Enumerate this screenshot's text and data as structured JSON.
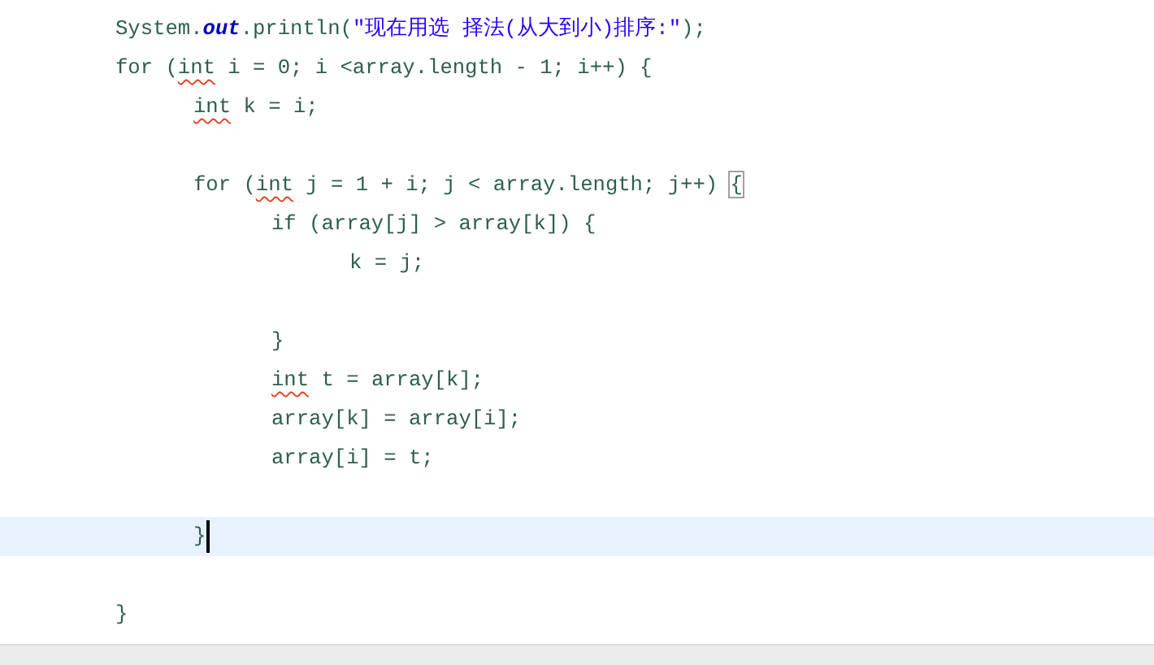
{
  "editor": {
    "lines": [
      {
        "kind": "code",
        "current": false,
        "tokens": [
          {
            "kind": "plain",
            "text": "\tSystem."
          },
          {
            "kind": "field",
            "text": "out"
          },
          {
            "kind": "plain",
            "text": ".println("
          },
          {
            "kind": "string",
            "text": "\"现在用选 择法(从大到小)排序:\""
          },
          {
            "kind": "plain",
            "text": ");"
          }
        ]
      },
      {
        "kind": "code",
        "current": false,
        "tokens": [
          {
            "kind": "plain",
            "text": "\tfor ("
          },
          {
            "kind": "warn",
            "text": "int"
          },
          {
            "kind": "plain",
            "text": " i = 0; i <array.length - 1; i++) {"
          }
        ]
      },
      {
        "kind": "code",
        "current": false,
        "tokens": [
          {
            "kind": "warn",
            "text": "\t\tint"
          },
          {
            "kind": "plain",
            "text": " k = i;"
          }
        ]
      },
      {
        "kind": "blank",
        "current": false
      },
      {
        "kind": "code",
        "current": false,
        "tokens": [
          {
            "kind": "plain",
            "text": "\t\tfor ("
          },
          {
            "kind": "warn",
            "text": "int"
          },
          {
            "kind": "plain",
            "text": " j = 1 + i; j < array.length; j++) "
          },
          {
            "kind": "bracket",
            "text": "{"
          }
        ]
      },
      {
        "kind": "code",
        "current": false,
        "tokens": [
          {
            "kind": "plain",
            "text": "\t\t\tif (array[j] > array[k]) {"
          }
        ]
      },
      {
        "kind": "code",
        "current": false,
        "tokens": [
          {
            "kind": "plain",
            "text": "\t\t\t\tk = j;"
          }
        ]
      },
      {
        "kind": "blank",
        "current": false
      },
      {
        "kind": "code",
        "current": false,
        "tokens": [
          {
            "kind": "plain",
            "text": "\t\t\t}"
          }
        ]
      },
      {
        "kind": "code",
        "current": false,
        "tokens": [
          {
            "kind": "warn",
            "text": "\t\t\tint"
          },
          {
            "kind": "plain",
            "text": " t = array[k];"
          }
        ]
      },
      {
        "kind": "code",
        "current": false,
        "tokens": [
          {
            "kind": "plain",
            "text": "\t\t\tarray[k] = array[i];"
          }
        ]
      },
      {
        "kind": "code",
        "current": false,
        "tokens": [
          {
            "kind": "plain",
            "text": "\t\t\tarray[i] = t;"
          }
        ]
      },
      {
        "kind": "blank",
        "current": false
      },
      {
        "kind": "code",
        "current": true,
        "tokens": [
          {
            "kind": "plain",
            "text": "\t\t}"
          }
        ]
      },
      {
        "kind": "blank",
        "current": false
      },
      {
        "kind": "code",
        "current": false,
        "tokens": [
          {
            "kind": "plain",
            "text": "\t}"
          }
        ]
      }
    ]
  }
}
